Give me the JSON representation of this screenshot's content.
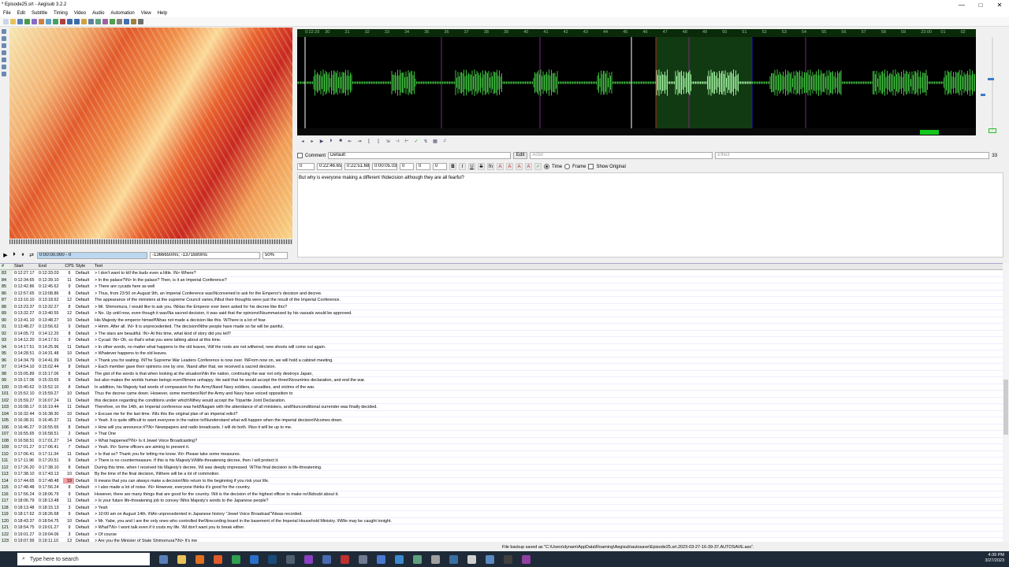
{
  "window": {
    "title": "* Episode25.srt - Aegisub 3.2.2",
    "minimize": "—",
    "maximize": "□",
    "close": "✕"
  },
  "menu": [
    "File",
    "Edit",
    "Subtitle",
    "Timing",
    "Video",
    "Audio",
    "Automation",
    "View",
    "Help"
  ],
  "video": {
    "time": "0:00:00.000 - 0",
    "offset": "-1366650ms; -1371680ms",
    "zoom": "50%"
  },
  "audio": {
    "ruler": [
      "0:22:29",
      "30",
      "31",
      "32",
      "33",
      "34",
      "35",
      "36",
      "37",
      "38",
      "39",
      "40",
      "41",
      "42",
      "43",
      "44",
      "45",
      "46",
      "47",
      "48",
      "49",
      "50",
      "51",
      "52",
      "53",
      "54",
      "55",
      "56",
      "57",
      "58",
      "59",
      "23:00",
      "01",
      "02"
    ]
  },
  "edit": {
    "comment_label": "Comment",
    "style": "Default",
    "edit_label": "Edit",
    "actor_placeholder": "Actor",
    "effect_placeholder": "Effect",
    "effect_count": "33",
    "layer": "0",
    "start": "0:22:46.65",
    "end": "0:22:51.68",
    "duration": "0:00:05.03",
    "margin_l": "0",
    "margin_r": "0",
    "margin_v": "0",
    "time_label": "Time",
    "frame_label": "Frame",
    "show_original_label": "Show Original",
    "text": "But why is everyone making a different \\Ndecision although they are all fearful?"
  },
  "grid": {
    "headers": [
      "#",
      "Start",
      "End",
      "CPS",
      "Style",
      "Text"
    ],
    "rows": [
      [
        "83",
        "0:12:27.17",
        "0:12:33.03",
        "6",
        "Default",
        "> I don't want to kill the buds even a little. \\N> Where?"
      ],
      [
        "84",
        "0:12:34.65",
        "0:12:39.10",
        "11",
        "Default",
        "> In the palace?\\N> In the palace? Then, is it an Imperial Conference?"
      ],
      [
        "85",
        "0:12:42.86",
        "0:12:45.62",
        "9",
        "Default",
        "> There are cycads here as well"
      ],
      [
        "86",
        "0:12:57.65",
        "0:13:08.86",
        "8",
        "Default",
        "> Thus, from 23:50 on August 9th, an Imperial Conference was\\Nconvened to ask for the Emperor's decision and decree."
      ],
      [
        "87",
        "0:13:10.10",
        "0:13:18.62",
        "12",
        "Default",
        "The appearance of the ministers at the supreme Council varies,\\Nbut their thoughts were just the result of the Imperial Conference."
      ],
      [
        "88",
        "0:13:23.37",
        "0:13:32.27",
        "8",
        "Default",
        "> Mr. Shimomura, I would like to ask you. \\NHas the Emperor ever been asked for his decree like this?"
      ],
      [
        "89",
        "0:13:32.27",
        "0:13:40.55",
        "12",
        "Default",
        "> No. Up until now, even though it was\\Na sacred decision, it was said that the opinions\\Nsummarized by his vassals would be approved."
      ],
      [
        "90",
        "0:13:41.10",
        "0:13:48.27",
        "10",
        "Default",
        "His Majesty the emperor himself\\Nhas not made a decision like this. \\NThere is a lot of fear."
      ],
      [
        "91",
        "0:13:48.27",
        "0:13:56.62",
        "9",
        "Default",
        "> Hmm. After all. \\N> It is unprecedented. The decision\\Nthe people have made so far will be painful,"
      ],
      [
        "92",
        "0:14:05.72",
        "0:14:12.20",
        "8",
        "Default",
        "> The stars are beautiful. \\N> At this time, what kind of story did you tell?"
      ],
      [
        "93",
        "0:14:12.20",
        "0:14:17.51",
        "9",
        "Default",
        "> Cycad. \\N> Oh, so that's what you were talking about at this time."
      ],
      [
        "94",
        "0:14:17.51",
        "0:14:25.96",
        "11",
        "Default",
        "> In other words, no matter what happens to the old leaves, \\Nif the roots are not withered, new shoots will come out again."
      ],
      [
        "95",
        "0:14:28.51",
        "0:14:31.48",
        "10",
        "Default",
        "> Whatever happens to the old leaves."
      ],
      [
        "96",
        "0:14:34.79",
        "0:14:41.99",
        "13",
        "Default",
        "> Thank you for waiting. \\NThe Supreme War Leaders Conference is now over. \\NFrom now on, we will hold a cabinet meeting."
      ],
      [
        "97",
        "0:14:54.10",
        "0:15:02.44",
        "8",
        "Default",
        "> Each member gave their opinions one by one, \\Nand after that, we received a sacred decision."
      ],
      [
        "98",
        "0:15:05.89",
        "0:15:17.06",
        "8",
        "Default",
        "The gist of the words is that when looking at the situation\\Nin the nation, continuing the war not only destroys Japan,"
      ],
      [
        "99",
        "0:15:17.06",
        "0:15:33.65",
        "6",
        "Default",
        "but also makes the worlds human beings even\\Nmore unhappy. He said that he would accept the three\\Ncountries declaration, and end the war."
      ],
      [
        "100",
        "0:15:40.62",
        "0:15:52.10",
        "8",
        "Default",
        "In addition, his Majesty had words of compassion for the Army\\Nand Navy soldiers, casualties, and victims of the war."
      ],
      [
        "101",
        "0:15:52.10",
        "0:15:59.27",
        "10",
        "Default",
        "Thus the decree came down. However, some members\\Nof the Army and Navy have voiced opposition to"
      ],
      [
        "102",
        "0:15:59.27",
        "0:16:07.24",
        "11",
        "Default",
        "this decision regarding the conditions under which\\Nthey would accept the Tripartite Joint Declaration."
      ],
      [
        "103",
        "0:16:08.17",
        "0:16:19.44",
        "11",
        "Default",
        "Therefore, on the 14th, an Imperial conference was held\\Nagain with the attendance of all ministers, and\\Nunconditional surrender was finally decided."
      ],
      [
        "104",
        "0:16:32.44",
        "0:16:38.30",
        "10",
        "Default",
        "> Excuse me for the last time. \\NIs this the original plan of an imperial edict?"
      ],
      [
        "105",
        "0:16:38.31",
        "0:16:45.37",
        "11",
        "Default",
        "> Yeah. It is quite difficult to want everyone in the nation to\\Nunderstand what will happen when the imperial decision\\Ncomes down."
      ],
      [
        "106",
        "0:16:46.27",
        "0:16:55.65",
        "8",
        "Default",
        "> How will you announce it?\\N> Newspapers and radio broadcasts. I will do both. \\Nso it will be up to me."
      ],
      [
        "107",
        "0:16:55.65",
        "0:16:58.51",
        "2",
        "Default",
        "> That One"
      ],
      [
        "108",
        "0:16:58.51",
        "0:17:01.27",
        "14",
        "Default",
        "> What happened?\\N> Is it Jewel Voice Broadcasting?"
      ],
      [
        "109",
        "0:17:01.27",
        "0:17:06.41",
        "7",
        "Default",
        "> Yeah. \\N> Some officers are aiming to prevent it."
      ],
      [
        "110",
        "0:17:06.41",
        "0:17:11.34",
        "11",
        "Default",
        "> Is that so? Thank you for letting me know. \\N> Please take some measures."
      ],
      [
        "111",
        "0:17:11.96",
        "0:17:20.51",
        "9",
        "Default",
        "> There is no countermeasure. If this is his Majesty's\\Nlife-threatening decree, then I will protect it."
      ],
      [
        "112",
        "0:17:26.20",
        "0:17:38.10",
        "8",
        "Default",
        "During this time, when I received his Majesty's decree, \\NI was deeply impressed. \\NThis final decision is life-threatening."
      ],
      [
        "113",
        "0:17:38.10",
        "0:17:43.13",
        "10",
        "Default",
        "By the time of the final decision, \\Nthere will be a lot of commotion."
      ],
      [
        "114",
        "0:17:44.65",
        "0:17:48.48",
        "19",
        "Default",
        "It means that you can always make a decision\\Nto return to the beginning if you risk your life."
      ],
      [
        "115",
        "0:17:48.48",
        "0:17:56.24",
        "8",
        "Default",
        "> I also made a lot of noise. \\N> However, everyone thinks it's good for the country."
      ],
      [
        "116",
        "0:17:56.24",
        "0:18:06.79",
        "9",
        "Default",
        "However, there are many things that are good for the country. \\NIt is the decision of the highest officer to make no\\Ndoubt about it."
      ],
      [
        "117",
        "0:18:06.79",
        "0:18:13.48",
        "11",
        "Default",
        "> Is your future life-threatening job to convey \\Nhis Majesty's words to the Japanese people?"
      ],
      [
        "118",
        "0:18:13.48",
        "0:18:15.13",
        "3",
        "Default",
        "> Yeah"
      ],
      [
        "119",
        "0:18:17.62",
        "0:18:26.68",
        "9",
        "Default",
        "> 10:00 am on August 14th. \\NAn unprecedented in Japanese history \"Jewel Voice Broadcast\"\\Nwas recorded."
      ],
      [
        "120",
        "0:18:43.37",
        "0:18:54.75",
        "10",
        "Default",
        "> Mr. Yabe, you and I are the only ones who controlled the\\Nrecording board in the basement of the Imperial Household Ministry. \\NWe may be caught tonight."
      ],
      [
        "121",
        "0:18:54.75",
        "0:19:01.27",
        "9",
        "Default",
        "> What?\\N> I wont talk even if it costs my life. \\NI don't want you to break either."
      ],
      [
        "122",
        "0:19:01.27",
        "0:19:04.06",
        "3",
        "Default",
        "> Of course"
      ],
      [
        "123",
        "0:19:07.99",
        "0:19:11.10",
        "13",
        "Default",
        "> Are you the Minister of State Shimomura?\\N> It's me"
      ]
    ]
  },
  "status": {
    "text": "File backup saved as \"C:\\Users\\dynam\\AppData\\Roaming\\Aegisub\\autosave\\Episode25.srt.2023-03-27-16-39-37.AUTOSAVE.ass\"."
  },
  "taskbar": {
    "search_placeholder": "Type here to search",
    "time": "4:39 PM",
    "date": "3/27/2023"
  }
}
